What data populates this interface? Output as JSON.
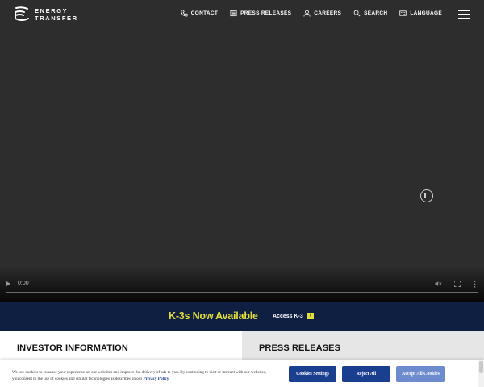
{
  "header": {
    "logo_line1": "ENERGY",
    "logo_line2": "TRANSFER",
    "nav": [
      {
        "label": "CONTACT",
        "icon": "phone-icon"
      },
      {
        "label": "PRESS RELEASES",
        "icon": "newspaper-icon"
      },
      {
        "label": "CAREERS",
        "icon": "person-icon"
      },
      {
        "label": "SEARCH",
        "icon": "search-icon"
      },
      {
        "label": "LANGUAGE",
        "icon": "language-icon"
      }
    ],
    "menu_icon": "hamburger-menu-icon"
  },
  "video": {
    "time": "0:00",
    "state": "playing",
    "pause_icon": "pause-icon",
    "play_icon": "play-icon",
    "mute_icon": "muted-speaker-icon",
    "fullscreen_icon": "fullscreen-icon",
    "more_icon": "more-options-icon"
  },
  "banner": {
    "title": "K-3s Now Available",
    "link_label": "Access K-3",
    "arrow": "›",
    "accent_color": "#e3df3a",
    "background_color": "#0f1f41"
  },
  "sections": {
    "left_title": "INVESTOR INFORMATION",
    "right_title": "PRESS RELEASES"
  },
  "cookie": {
    "text": "We use cookies to enhance your experience on our websites and improve the delivery of ads to you. By continuing to visit or interact with our websites, you consent to the use of cookies and similar technologies as described in our",
    "policy_link": "Privacy Policy",
    "settings_label": "Cookies Settings",
    "reject_label": "Reject All",
    "accept_label": "Accept All Cookies",
    "button_color": "#1b3f8f",
    "accept_color": "#6f8bd0"
  }
}
